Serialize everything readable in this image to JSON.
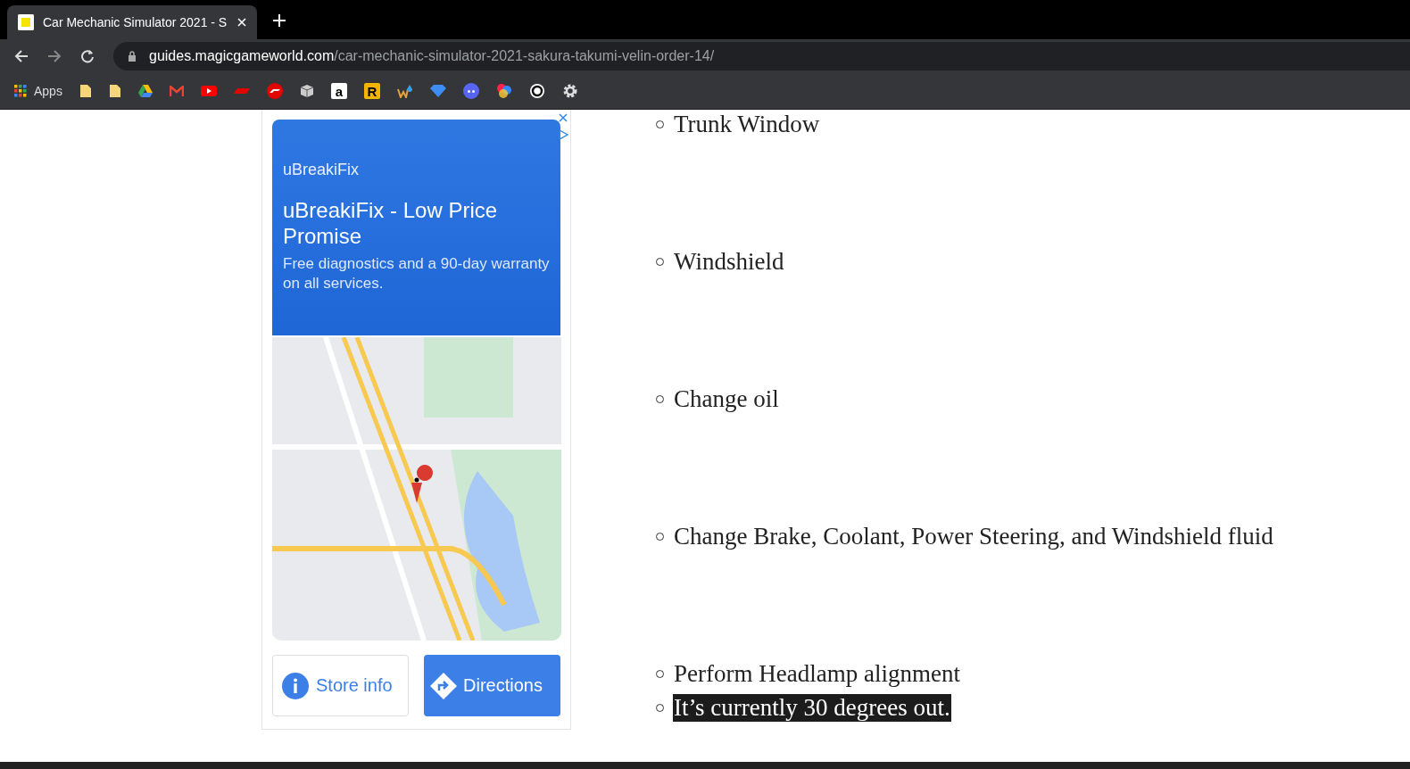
{
  "browser": {
    "tab": {
      "title": "Car Mechanic Simulator 2021 - S",
      "selected": true
    },
    "url": {
      "domain": "guides.magicgameworld.com",
      "path": "/car-mechanic-simulator-2021-sakura-takumi-velin-order-14/"
    },
    "bookmarks": [
      {
        "kind": "apps",
        "label": "Apps"
      },
      {
        "kind": "folder"
      },
      {
        "kind": "folder"
      },
      {
        "kind": "drive"
      },
      {
        "kind": "mail"
      },
      {
        "kind": "video"
      },
      {
        "kind": "stripe"
      },
      {
        "kind": "racing"
      },
      {
        "kind": "box"
      },
      {
        "kind": "letter",
        "label": "a"
      },
      {
        "kind": "letter-gold",
        "label": "R"
      },
      {
        "kind": "weather"
      },
      {
        "kind": "gem"
      },
      {
        "kind": "chat"
      },
      {
        "kind": "colorful"
      },
      {
        "kind": "ring"
      },
      {
        "kind": "gear"
      }
    ]
  },
  "ad": {
    "advertiser": "uBreakiFix",
    "headline": "uBreakiFix - Low Price Promise",
    "description": "Free diagnostics and a 90-day warranty on all services.",
    "buttons": [
      {
        "kind": "info",
        "label": "Store info"
      },
      {
        "kind": "directions",
        "label": "Directions"
      }
    ]
  },
  "list": [
    {
      "text": "Trunk Window",
      "highlighted": false
    },
    {
      "text": "Windshield",
      "highlighted": false
    },
    {
      "text": "Change oil",
      "highlighted": false
    },
    {
      "text": "Change Brake, Coolant, Power Steering, and Windshield fluid",
      "highlighted": false
    },
    {
      "text": "Perform Headlamp alignment",
      "highlighted": false
    },
    {
      "text": "It’s currently 30 degrees out.",
      "highlighted": true
    }
  ]
}
